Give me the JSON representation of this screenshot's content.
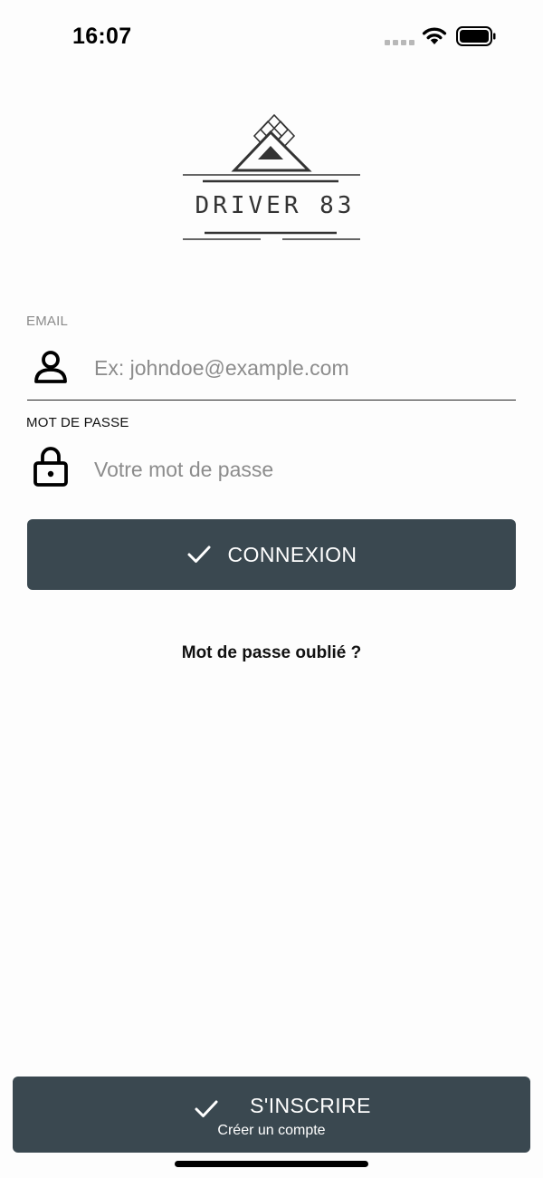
{
  "status_bar": {
    "time": "16:07",
    "icons": [
      "signal-icon",
      "wifi-icon",
      "battery-icon"
    ]
  },
  "logo": {
    "text": "DRIVER 83"
  },
  "form": {
    "email": {
      "label": "EMAIL",
      "placeholder": "Ex: johndoe@example.com",
      "value": "",
      "icon": "user-icon"
    },
    "password": {
      "label": "MOT DE PASSE",
      "placeholder": "Votre mot de passe",
      "value": "",
      "icon": "lock-icon"
    },
    "connect_button": {
      "label": "CONNEXION",
      "icon": "check-icon"
    },
    "forgot_link": "Mot de passe oublié ?"
  },
  "register_button": {
    "label": "S'INSCRIRE",
    "sublabel": "Créer un compte",
    "icon": "check-icon"
  },
  "colors": {
    "button_bg": "#3a4850",
    "button_text": "#ffffff",
    "background": "#fdfdfd",
    "placeholder": "#8c8c8c"
  }
}
